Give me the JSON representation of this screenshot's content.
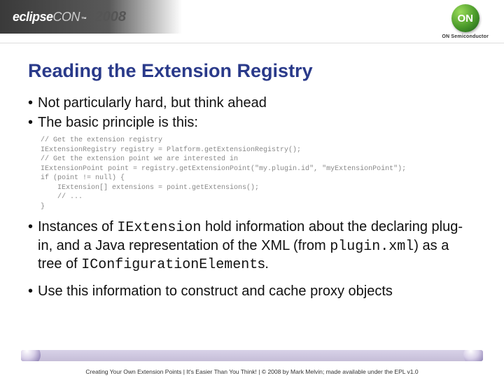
{
  "header": {
    "logo_main": "eclipse",
    "logo_sub": "CON",
    "logo_tm": "™",
    "year": "2008",
    "on_label": "ON",
    "on_sub": "ON Semiconductor"
  },
  "title": "Reading the Extension Registry",
  "bullets": {
    "b1": "Not particularly hard, but think ahead",
    "b2": "The basic principle is this:",
    "b3_pre": "Instances of ",
    "b3_code1": "IExtension",
    "b3_mid": " hold information about the declaring plug-in, and a Java representation of the XML (from ",
    "b3_code2": "plugin.xml",
    "b3_mid2": ") as a tree of ",
    "b3_code3": "IConfigurationElement",
    "b3_post": "s.",
    "b4": "Use this information to construct and cache proxy objects"
  },
  "code": "// Get the extension registry\nIExtensionRegistry registry = Platform.getExtensionRegistry();\n// Get the extension point we are interested in\nIExtensionPoint point = registry.getExtensionPoint(\"my.plugin.id\", \"myExtensionPoint\");\nif (point != null) {\n    IExtension[] extensions = point.getExtensions();\n    // ...\n}",
  "footer": "Creating Your Own Extension Points  |  It's Easier Than You Think!  |  © 2008 by Mark Melvin; made available under the EPL v1.0"
}
